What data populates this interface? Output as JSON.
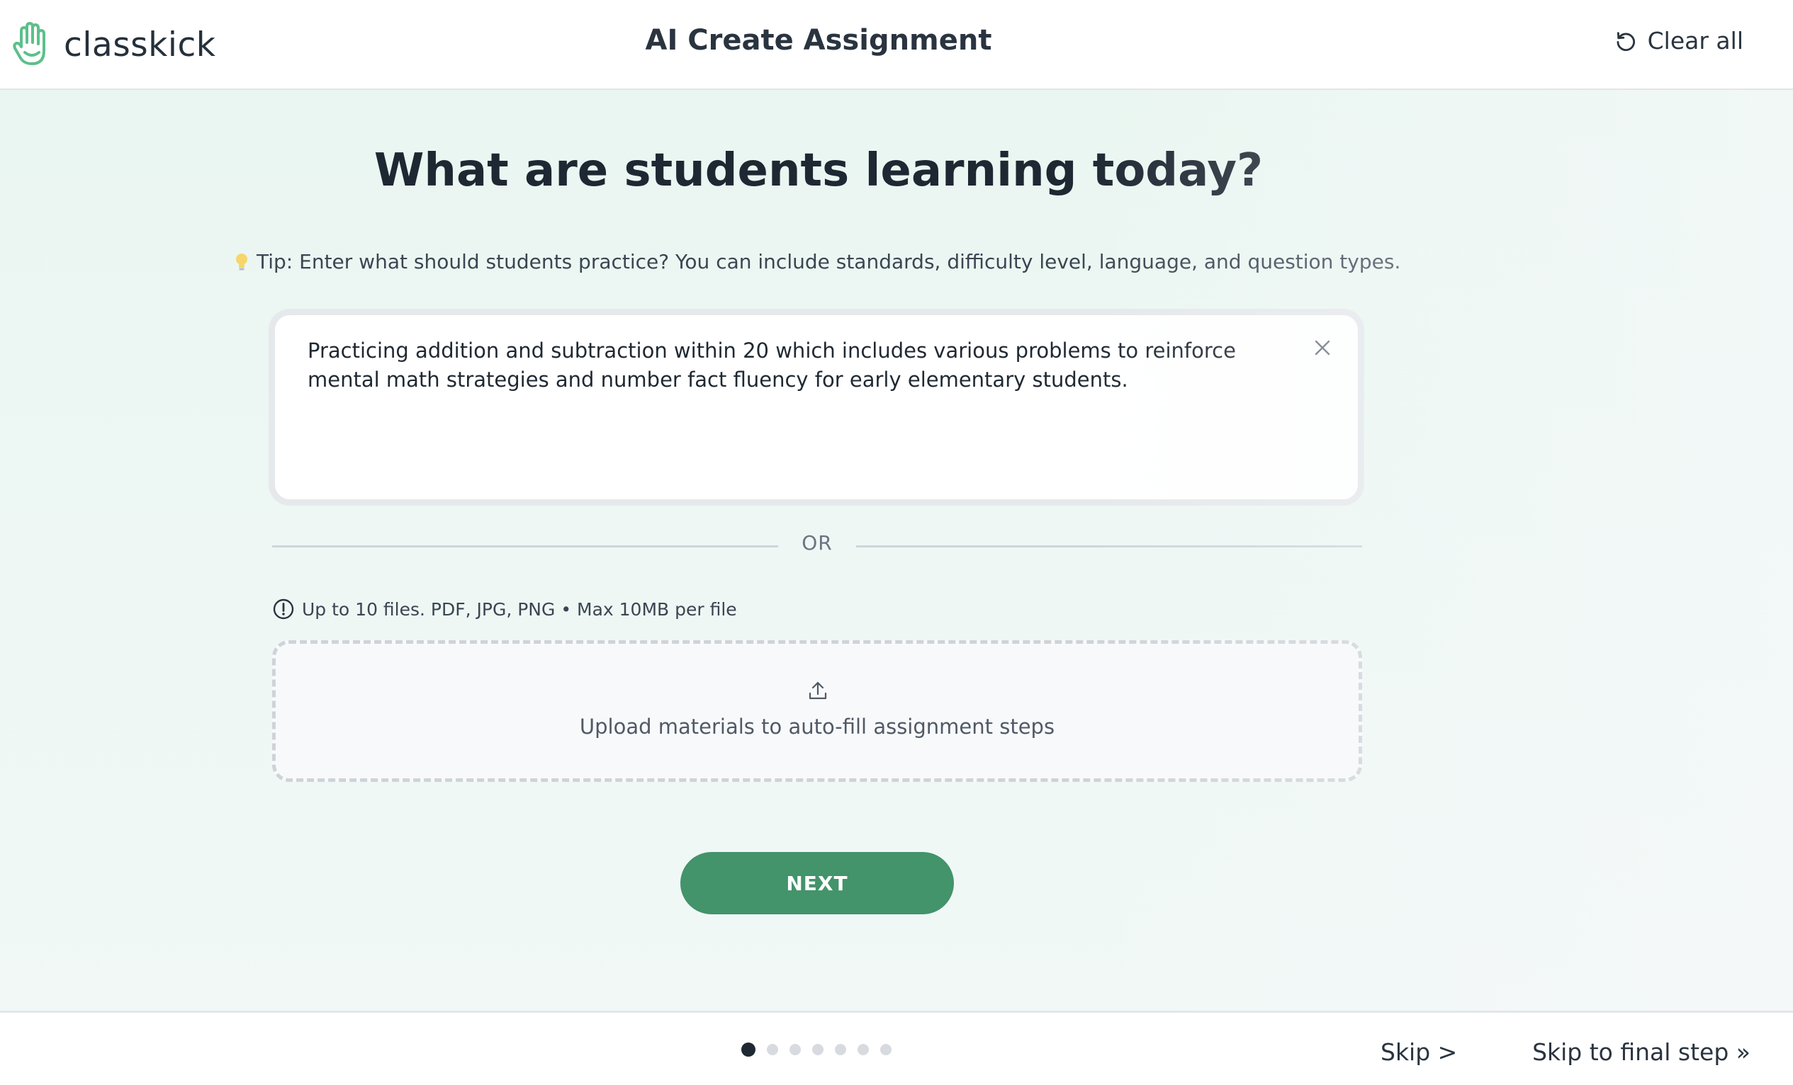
{
  "header": {
    "logo_text": "classkick",
    "title": "AI Create Assignment",
    "clear_all_label": "Clear all"
  },
  "main": {
    "question": "What are students learning today?",
    "tip": "Tip: Enter what should students practice? You can include standards, difficulty level, language, and question types.",
    "prompt_value": "Practicing addition and subtraction within 20 which includes various problems to reinforce mental math strategies and number fact fluency for early elementary students.",
    "or_label": "OR",
    "file_note": "Up to 10 files. PDF, JPG, PNG • Max 10MB per file",
    "upload_label": "Upload materials to auto-fill assignment steps",
    "next_label": "NEXT"
  },
  "footer": {
    "progress": {
      "current_step": 1,
      "total_steps": 7
    },
    "skip_label": "Skip >",
    "skip_final_label": "Skip to final step »"
  },
  "colors": {
    "brand_green": "#43936b",
    "logo_green": "#5cc08a",
    "text_dark": "#1f2933"
  },
  "icons": {
    "logo": "hand-wave-icon",
    "clear_all": "refresh-icon",
    "tip": "lightbulb-icon",
    "clear_prompt": "close-icon",
    "file_note": "info-circle-icon",
    "upload": "upload-icon"
  }
}
